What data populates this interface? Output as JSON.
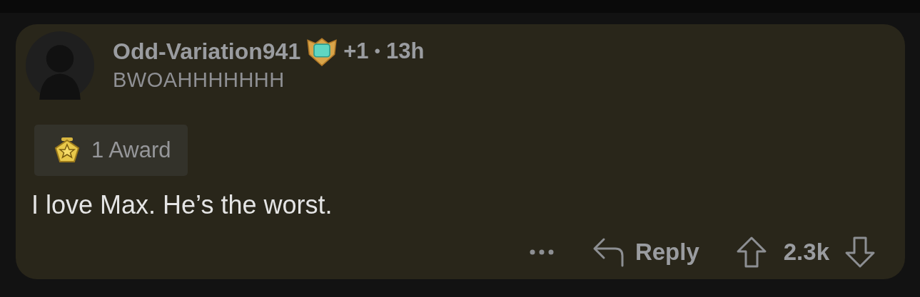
{
  "comment": {
    "author": "Odd-Variation941",
    "karma": "+1",
    "separator": "•",
    "age": "13h",
    "flair": "BWOAHHHHHHH",
    "award": {
      "label": "1 Award"
    },
    "body": "I love Max. He’s the worst.",
    "actions": {
      "reply": "Reply",
      "score": "2.3k"
    }
  }
}
